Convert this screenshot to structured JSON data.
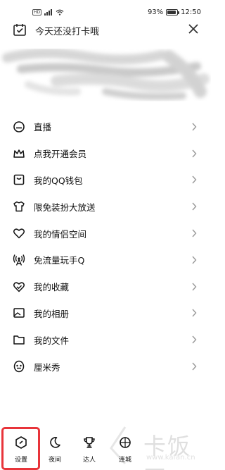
{
  "status_bar": {
    "network": "HD",
    "battery_percent": "93%",
    "battery_level": 0.93,
    "time": "12:50"
  },
  "header": {
    "checkin_text": "今天还没打卡哦"
  },
  "menu": {
    "items": [
      {
        "label": "直播",
        "icon": "live-icon"
      },
      {
        "label": "点我开通会员",
        "icon": "crown-icon"
      },
      {
        "label": "我的QQ钱包",
        "icon": "wallet-icon"
      },
      {
        "label": "限免装扮大放送",
        "icon": "tshirt-icon"
      },
      {
        "label": "我的情侣空间",
        "icon": "heart-icon"
      },
      {
        "label": "免流量玩手Q",
        "icon": "signal-tower-icon"
      },
      {
        "label": "我的收藏",
        "icon": "favorite-heart-icon"
      },
      {
        "label": "我的相册",
        "icon": "album-icon"
      },
      {
        "label": "我的文件",
        "icon": "folder-icon"
      },
      {
        "label": "厘米秀",
        "icon": "cmshow-face-icon"
      }
    ]
  },
  "bottom_bar": {
    "tabs": [
      {
        "label": "设置",
        "icon": "settings-hexagon-icon"
      },
      {
        "label": "夜间",
        "icon": "moon-icon"
      },
      {
        "label": "达人",
        "icon": "trophy-icon"
      },
      {
        "label": "连城",
        "icon": "city-icon"
      }
    ]
  },
  "watermark": {
    "text": "卡饭网",
    "url": "www.kafan.cn"
  },
  "colors": {
    "highlight": "#e8343a",
    "text": "#111111"
  }
}
